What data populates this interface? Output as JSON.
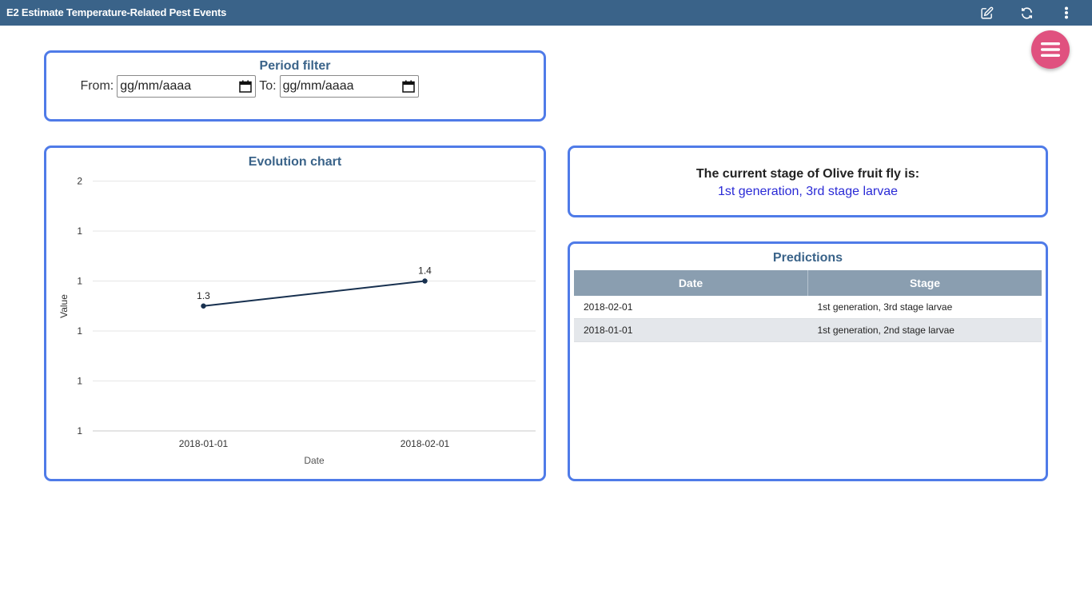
{
  "app": {
    "title": "E2 Estimate Temperature-Related Pest Events"
  },
  "toolbar": {
    "icons": [
      "edit-icon",
      "refresh-icon",
      "more-vert-icon"
    ]
  },
  "fab": {
    "icon": "menu-icon",
    "color": "#e0517f"
  },
  "period_filter": {
    "title": "Period filter",
    "from_label": "From:",
    "from_placeholder": "gg/mm/aaaa",
    "to_label": "To:",
    "to_placeholder": "gg/mm/aaaa"
  },
  "evolution": {
    "title": "Evolution chart",
    "xlabel": "Date",
    "ylabel": "Value",
    "yticks": [
      "2",
      "1",
      "1",
      "1",
      "1",
      "1"
    ],
    "line_color": "#17304f"
  },
  "chart_data": {
    "type": "line",
    "title": "Evolution chart",
    "xlabel": "Date",
    "ylabel": "Value",
    "categories": [
      "2018-01-01",
      "2018-02-01"
    ],
    "values": [
      1.3,
      1.4
    ],
    "data_labels": [
      "1.3",
      "1.4"
    ],
    "ylim": [
      0.8,
      1.8
    ],
    "ytick_labels": [
      "2",
      "1",
      "1",
      "1",
      "1",
      "1"
    ],
    "grid": true
  },
  "current_stage": {
    "question": "The current stage of Olive fruit fly is:",
    "answer": "1st generation, 3rd stage larvae",
    "answer_color": "#2a2ad6"
  },
  "predictions": {
    "title": "Predictions",
    "columns": [
      "Date",
      "Stage"
    ],
    "rows": [
      {
        "date": "2018-02-01",
        "stage": "1st generation, 3rd stage larvae"
      },
      {
        "date": "2018-01-01",
        "stage": "1st generation, 2nd stage larvae"
      }
    ]
  },
  "colors": {
    "header": "#3a6389",
    "card_border": "#4f7be8",
    "table_header": "#8a9eb0"
  }
}
